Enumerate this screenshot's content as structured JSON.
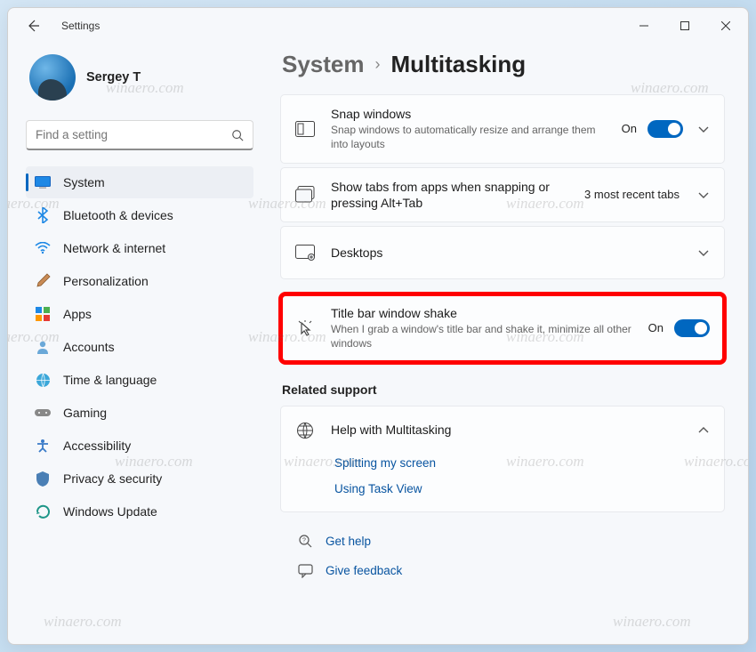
{
  "window": {
    "title": "Settings"
  },
  "profile": {
    "name": "Sergey T"
  },
  "search": {
    "placeholder": "Find a setting"
  },
  "nav": [
    {
      "label": "System",
      "selected": true
    },
    {
      "label": "Bluetooth & devices"
    },
    {
      "label": "Network & internet"
    },
    {
      "label": "Personalization"
    },
    {
      "label": "Apps"
    },
    {
      "label": "Accounts"
    },
    {
      "label": "Time & language"
    },
    {
      "label": "Gaming"
    },
    {
      "label": "Accessibility"
    },
    {
      "label": "Privacy & security"
    },
    {
      "label": "Windows Update"
    }
  ],
  "breadcrumb": {
    "parent": "System",
    "current": "Multitasking"
  },
  "cards": {
    "snap": {
      "title": "Snap windows",
      "desc": "Snap windows to automatically resize and arrange them into layouts",
      "state": "On"
    },
    "tabs": {
      "title": "Show tabs from apps when snapping or pressing Alt+Tab",
      "value": "3 most recent tabs"
    },
    "desktops": {
      "title": "Desktops"
    },
    "shake": {
      "title": "Title bar window shake",
      "desc": "When I grab a window's title bar and shake it, minimize all other windows",
      "state": "On"
    }
  },
  "related": {
    "label": "Related support"
  },
  "support": {
    "title": "Help with Multitasking",
    "links": [
      "Splitting my screen",
      "Using Task View"
    ]
  },
  "footer": {
    "help": "Get help",
    "feedback": "Give feedback"
  },
  "watermark": "winaero.com"
}
